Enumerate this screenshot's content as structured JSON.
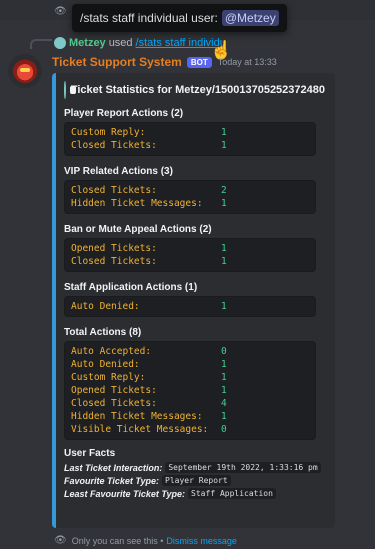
{
  "tooltip": {
    "text": "/stats staff individual user:",
    "mention": "@Metzey"
  },
  "reply": {
    "username": "Metzey",
    "used_text": "used",
    "command": "/stats staff individu"
  },
  "header": {
    "bot_name": "Ticket Support System",
    "bot_tag": "BOT",
    "timestamp": "Today at 13:33"
  },
  "embed": {
    "title": "Ticket Statistics for Metzey/150013705252372480",
    "accent_color": "#3498db",
    "fields": [
      {
        "name": "Player Report Actions (2)",
        "rows": [
          {
            "key": "Custom Reply:",
            "value": "1"
          },
          {
            "key": "Closed Tickets:",
            "value": "1"
          }
        ]
      },
      {
        "name": "VIP Related Actions (3)",
        "rows": [
          {
            "key": "Closed Tickets:",
            "value": "2"
          },
          {
            "key": "Hidden Ticket Messages:",
            "value": "1"
          }
        ]
      },
      {
        "name": "Ban or Mute Appeal Actions (2)",
        "rows": [
          {
            "key": "Opened Tickets:",
            "value": "1"
          },
          {
            "key": "Closed Tickets:",
            "value": "1"
          }
        ]
      },
      {
        "name": "Staff Application Actions (1)",
        "rows": [
          {
            "key": "Auto Denied:",
            "value": "1"
          }
        ]
      },
      {
        "name": "Total Actions (8)",
        "rows": [
          {
            "key": "Auto Accepted:",
            "value": "0"
          },
          {
            "key": "Auto Denied:",
            "value": "1"
          },
          {
            "key": "Custom Reply:",
            "value": "1"
          },
          {
            "key": "Opened Tickets:",
            "value": "1"
          },
          {
            "key": "Closed Tickets:",
            "value": "4"
          },
          {
            "key": "Hidden Ticket Messages:",
            "value": "1"
          },
          {
            "key": "Visible Ticket Messages:",
            "value": "0"
          }
        ]
      }
    ],
    "user_facts": {
      "name": "User Facts",
      "items": [
        {
          "key": "Last Ticket Interaction:",
          "value": "September 19th 2022, 1:33:16 pm"
        },
        {
          "key": "Favourite Ticket Type:",
          "value": "Player Report"
        },
        {
          "key": "Least Favourite Ticket Type:",
          "value": "Staff Application"
        }
      ]
    }
  },
  "footer": {
    "text": "Only you can see this •",
    "dismiss": "Dismiss message"
  }
}
